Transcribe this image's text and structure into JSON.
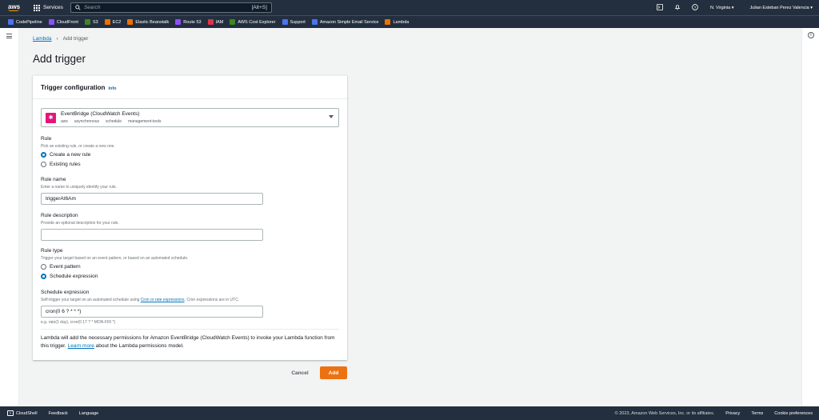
{
  "topnav": {
    "logo": "aws",
    "services_label": "Services",
    "search_placeholder": "Search",
    "search_shortcut": "[Alt+S]",
    "region": "N. Virginia ▾",
    "user": "Julian Esteban Perez Valencia ▾"
  },
  "favorites": [
    {
      "label": "CodePipeline",
      "color": "#4d72f3"
    },
    {
      "label": "CloudFront",
      "color": "#8c4fff"
    },
    {
      "label": "S3",
      "color": "#3f8624"
    },
    {
      "label": "EC2",
      "color": "#ed7100"
    },
    {
      "label": "Elastic Beanstalk",
      "color": "#ed7100"
    },
    {
      "label": "Route 53",
      "color": "#8c4fff"
    },
    {
      "label": "IAM",
      "color": "#dd344c"
    },
    {
      "label": "AWS Cost Explorer",
      "color": "#3f8624"
    },
    {
      "label": "Support",
      "color": "#4d72f3"
    },
    {
      "label": "Amazon Simple Email Service",
      "color": "#4d72f3"
    },
    {
      "label": "Lambda",
      "color": "#ed7100"
    }
  ],
  "breadcrumb": {
    "link": "Lambda",
    "separator": "›",
    "current": "Add trigger"
  },
  "page_title": "Add trigger",
  "panel": {
    "title": "Trigger configuration",
    "info": "Info",
    "source": {
      "title": "EventBridge (CloudWatch Events)",
      "tags": [
        "aws",
        "asynchronous",
        "schedule",
        "management-tools"
      ]
    },
    "rule": {
      "label": "Rule",
      "desc": "Pick an existing rule, or create a new one.",
      "options": [
        "Create a new rule",
        "Existing rules"
      ],
      "selected": "Create a new rule"
    },
    "rule_name": {
      "label": "Rule name",
      "desc": "Enter a name to uniquely identify your rule.",
      "value": "triggerAt6Am"
    },
    "rule_description": {
      "label": "Rule description",
      "desc": "Provide an optional description for your rule.",
      "value": ""
    },
    "rule_type": {
      "label": "Rule type",
      "desc": "Trigger your target based on an event pattern, or based on an automated schedule.",
      "options": [
        "Event pattern",
        "Schedule expression"
      ],
      "selected": "Schedule expression"
    },
    "schedule": {
      "label": "Schedule expression",
      "desc_before": "Self-trigger your target on an automated schedule using ",
      "desc_link": "Cron or rate expressions",
      "desc_after": ". Cron expressions are in UTC.",
      "value": "cron(0 6 ? * * *)",
      "hint": "e.g. rate(1 day), cron(0 17 ? * MON-FRI *)"
    },
    "note": {
      "before": "Lambda will add the necessary permissions for Amazon EventBridge (CloudWatch Events) to invoke your Lambda function from this trigger. ",
      "link": "Learn more",
      "after": " about the Lambda permissions model."
    }
  },
  "actions": {
    "cancel": "Cancel",
    "add": "Add"
  },
  "footer": {
    "cloudshell": "CloudShell",
    "feedback": "Feedback",
    "language": "Language",
    "copyright": "© 2023, Amazon Web Services, Inc. or its affiliates.",
    "privacy": "Privacy",
    "terms": "Terms",
    "cookies": "Cookie preferences"
  }
}
